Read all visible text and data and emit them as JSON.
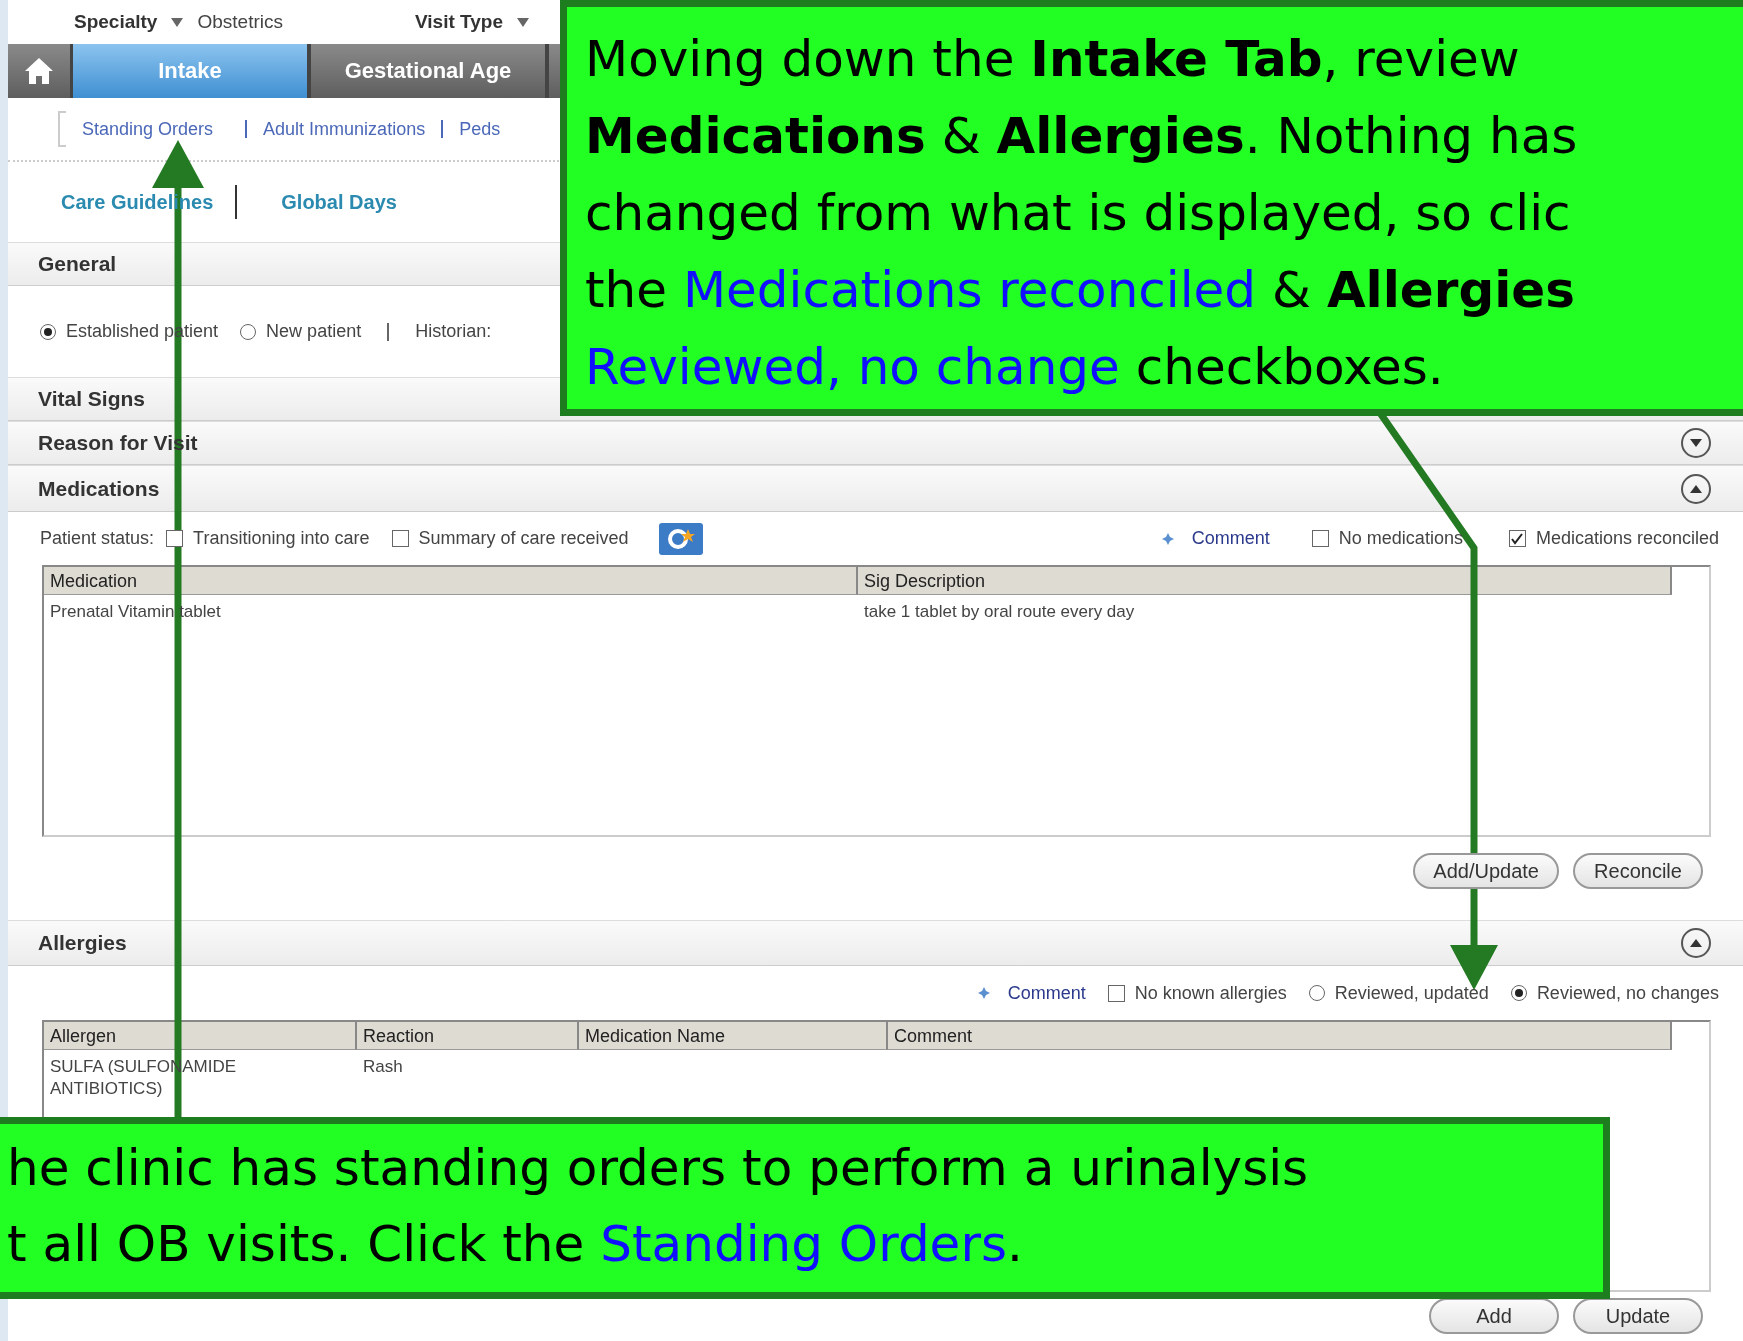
{
  "header": {
    "fields": [
      {
        "label": "Specialty",
        "value": "Obstetrics"
      },
      {
        "label": "Visit Type"
      }
    ]
  },
  "tabs": [
    {
      "label": "Intake",
      "selected": true
    },
    {
      "label": "Gestational Age",
      "selected": false
    }
  ],
  "sub_links": [
    "Standing Orders",
    "Adult Immunizations",
    "Peds"
  ],
  "links": [
    "Care Guidelines",
    "Global Days"
  ],
  "general": {
    "title": "General",
    "patient_types": [
      {
        "label": "Established patient",
        "selected": true
      },
      {
        "label": "New patient",
        "selected": false
      }
    ],
    "historian_label": "Historian:"
  },
  "collapsed_sections": [
    {
      "title": "Vital Signs"
    },
    {
      "title": "Reason for Visit",
      "expanded": false
    }
  ],
  "medications": {
    "title": "Medications",
    "expanded": true,
    "patient_status_label": "Patient status:",
    "status_checks": [
      {
        "label": "Transitioning into care",
        "checked": false
      },
      {
        "label": "Summary of care received",
        "checked": false
      }
    ],
    "comment": "Comment",
    "options": [
      {
        "label": "No medications",
        "checked": false
      },
      {
        "label": "Medications reconciled",
        "checked": true
      }
    ],
    "columns": [
      "Medication",
      "Sig Description"
    ],
    "rows": [
      [
        "Prenatal Vitamin tablet",
        "take 1 tablet by oral route  every day"
      ]
    ],
    "buttons": [
      "Add/Update",
      "Reconcile"
    ]
  },
  "allergies": {
    "title": "Allergies",
    "expanded": true,
    "comment": "Comment",
    "no_known": {
      "label": "No known allergies",
      "checked": false
    },
    "review": [
      {
        "label": "Reviewed, updated",
        "selected": false
      },
      {
        "label": "Reviewed, no changes",
        "selected": true
      }
    ],
    "columns": [
      "Allergen",
      "Reaction",
      "Medication Name",
      "Comment"
    ],
    "rows": [
      [
        "SULFA (SULFONAMIDE ANTIBIOTICS)",
        "Rash"
      ]
    ],
    "buttons": [
      "Add",
      "Update"
    ]
  },
  "callouts": [
    {
      "lines": [
        [
          {
            "kind": "plain",
            "text": "Moving down the "
          },
          {
            "kind": "bold",
            "text": "Intake Tab"
          },
          {
            "kind": "plain",
            "text": ", review"
          }
        ],
        [
          {
            "kind": "bold",
            "text": "Medications"
          },
          {
            "kind": "plain",
            "text": " & "
          },
          {
            "kind": "bold",
            "text": "Allergies"
          },
          {
            "kind": "plain",
            "text": ".  Nothing has"
          }
        ],
        [
          {
            "kind": "plain",
            "text": "changed from what is displayed, so clic"
          }
        ],
        [
          {
            "kind": "plain",
            "text": "the "
          },
          {
            "kind": "blue",
            "text": "Medications reconciled"
          },
          {
            "kind": "plain",
            "text": " & "
          },
          {
            "kind": "bold",
            "text": "Allergies"
          }
        ],
        [
          {
            "kind": "blue",
            "text": "Reviewed, no change"
          },
          {
            "kind": "plain",
            "text": " checkboxes."
          }
        ]
      ]
    },
    {
      "lines": [
        [
          {
            "kind": "plain",
            "text": "he clinic has standing orders to perform a urinalysis"
          }
        ],
        [
          {
            "kind": "plain",
            "text": "t all OB visits.  Click the "
          },
          {
            "kind": "blue",
            "text": "Standing Orders"
          },
          {
            "kind": "plain",
            "text": "."
          }
        ]
      ]
    }
  ]
}
